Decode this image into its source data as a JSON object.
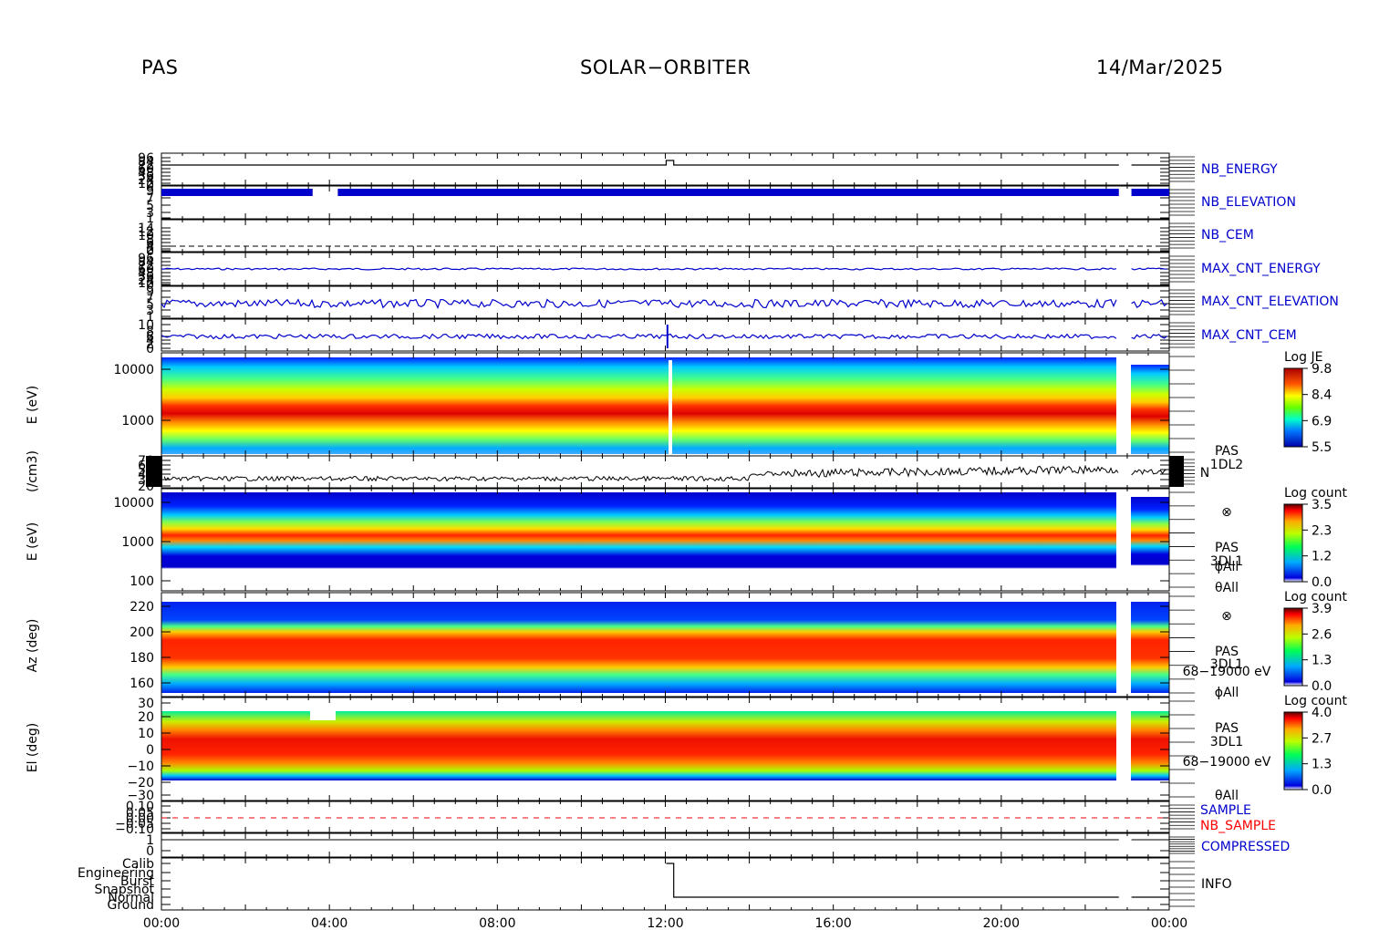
{
  "header": {
    "instrument": "PAS",
    "mission": "SOLAR−ORBITER",
    "date": "14/Mar/2025"
  },
  "colors": {
    "trace_blue": "#0000cc",
    "sample_red": "#ff0000",
    "frame": "#000000"
  },
  "chart_data": [
    {
      "type": "line",
      "title": "NB_ENERGY",
      "x_axis": {
        "labels": [
          "00:00",
          "04:00",
          "08:00",
          "12:00",
          "16:00",
          "20:00",
          "00:00"
        ],
        "range_hours": [
          0,
          24
        ]
      },
      "y_tick_labels": [
        "96",
        "84",
        "72",
        "60",
        "48",
        "36",
        "24",
        "12",
        "0"
      ],
      "annotation": "step up near 12:00"
    },
    {
      "type": "line",
      "title": "NB_ELEVATION",
      "y_tick_labels": [
        "9",
        "7",
        "5",
        "3",
        "1"
      ],
      "annotation": "dense blue trace, gap 03:40-04:10 and 22:50-23:10"
    },
    {
      "type": "line",
      "title": "NB_CEM",
      "y_tick_labels": [
        "14",
        "12",
        "10",
        "8",
        "6",
        "4",
        "2",
        "0"
      ]
    },
    {
      "type": "line",
      "title": "MAX_CNT_ENERGY",
      "y_tick_labels": [
        "96",
        "84",
        "72",
        "60",
        "48",
        "36",
        "24",
        "12",
        "0"
      ]
    },
    {
      "type": "line",
      "title": "MAX_CNT_ELEVATION",
      "y_tick_labels": [
        "9",
        "7",
        "5",
        "3",
        "1"
      ]
    },
    {
      "type": "line",
      "title": "MAX_CNT_CEM",
      "y_tick_labels": [
        "10",
        "8",
        "6",
        "4",
        "2",
        "0"
      ]
    },
    {
      "type": "heatmap",
      "ylabel": "E (eV)",
      "y_scale": "log",
      "y_tick_labels": [
        "10000",
        "1000"
      ],
      "colorbar": {
        "title": "Log JE",
        "ticks": [
          "9.8",
          "8.4",
          "6.9",
          "5.5"
        ]
      },
      "peak_energy_eV": 1000
    },
    {
      "type": "line",
      "ylabel": "(/cm3)",
      "y_tick_labels": [
        "70",
        "60",
        "50",
        "40",
        "30",
        "20"
      ],
      "labels": [
        "PAS",
        "1DL2",
        "N"
      ]
    },
    {
      "type": "heatmap",
      "ylabel": "E (eV)",
      "y_scale": "log",
      "y_tick_labels": [
        "10000",
        "1000",
        "100"
      ],
      "colorbar": {
        "title": "Log count",
        "ticks": [
          "3.5",
          "2.3",
          "1.2",
          "0.0"
        ]
      },
      "labels": [
        "⊗",
        "PAS",
        "3DL1",
        "ϕAll",
        "θAll"
      ]
    },
    {
      "type": "heatmap",
      "ylabel": "Az (deg)",
      "y_tick_labels": [
        "220",
        "200",
        "180",
        "160"
      ],
      "ylim": [
        155,
        225
      ],
      "colorbar": {
        "title": "Log count",
        "ticks": [
          "3.9",
          "2.6",
          "1.3",
          "0.0"
        ]
      },
      "labels": [
        "⊗",
        "PAS",
        "3DL1",
        "68−19000 eV",
        "ϕAll"
      ]
    },
    {
      "type": "heatmap",
      "ylabel": "El (deg)",
      "y_tick_labels": [
        "30",
        "20",
        "10",
        "0",
        "−10",
        "−20",
        "−30"
      ],
      "ylim": [
        -30,
        30
      ],
      "colorbar": {
        "title": "Log count",
        "ticks": [
          "4.0",
          "2.7",
          "1.3",
          "0.0"
        ]
      },
      "labels": [
        "PAS",
        "3DL1",
        "68−19000 eV",
        "θAll"
      ]
    },
    {
      "type": "line",
      "title": "SAMPLE",
      "y_tick_labels": [
        "0.10",
        "0.05",
        "0.00",
        "−0.05",
        "−0.10"
      ],
      "series": [
        {
          "name": "SAMPLE"
        },
        {
          "name": "NB_SAMPLE"
        }
      ]
    },
    {
      "type": "line",
      "title": "COMPRESSED",
      "y_tick_labels": [
        "1",
        "0"
      ]
    },
    {
      "type": "line",
      "title": "INFO",
      "y_tick_labels": [
        "Calib",
        "Engineering",
        "Burst",
        "Snapshot",
        "Normal",
        "Ground"
      ],
      "annotation": "switch Calib to Normal at ~12:10"
    }
  ]
}
